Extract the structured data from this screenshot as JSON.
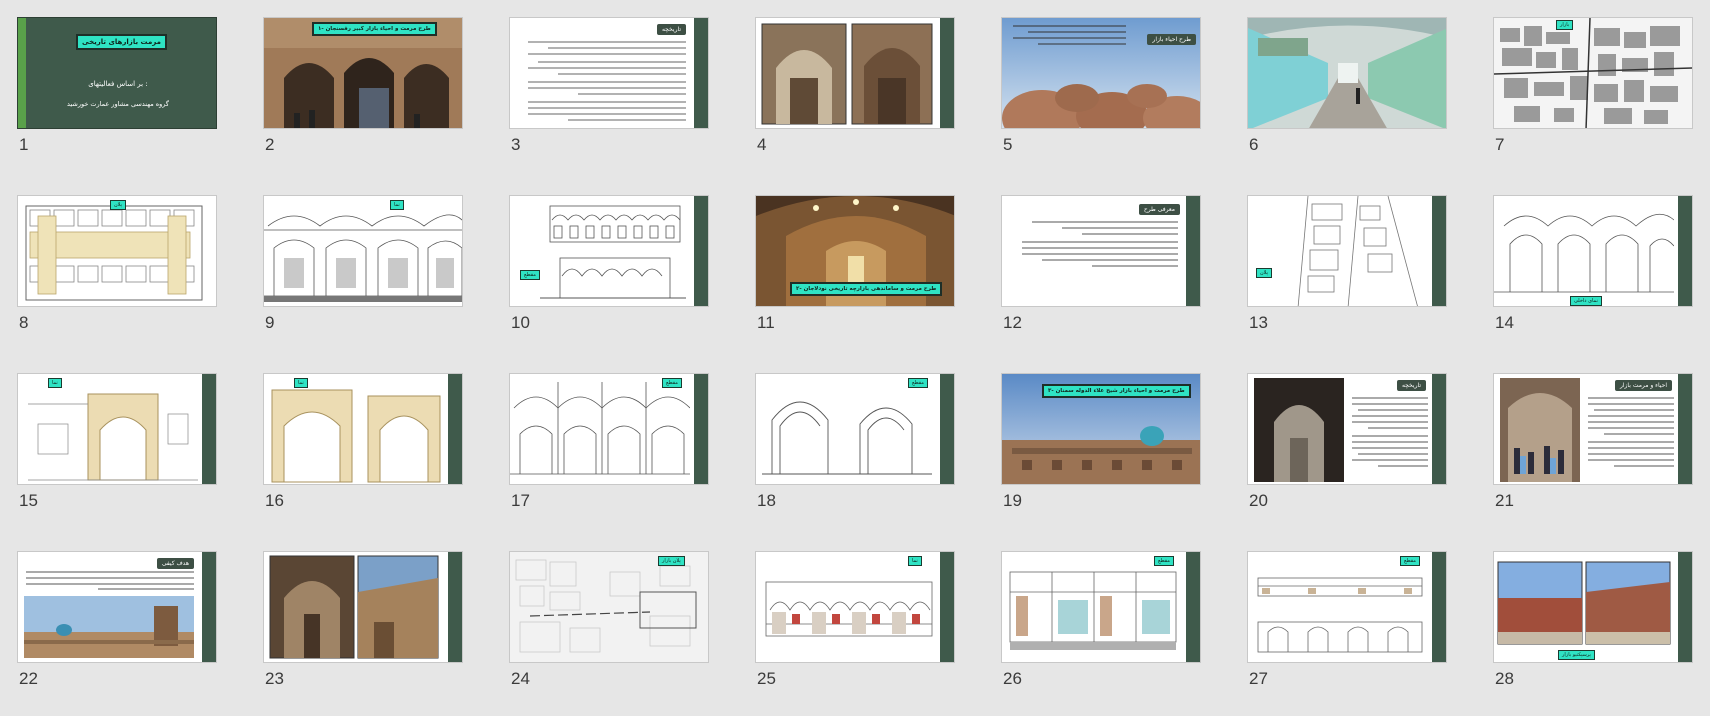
{
  "window": {
    "view": "slide-sorter",
    "slide_count": 28
  },
  "slides": [
    {
      "number": "1",
      "title": "مرمت بازارهای تاریخی",
      "subtitle": "بر اساس فعالیتهای :",
      "author": "گروه مهندسی مشاور عمارت خورشید"
    },
    {
      "number": "2",
      "caption": "۱- طرح مرمت و احیاء بازار کبیر رفسنجان"
    },
    {
      "number": "3",
      "title": "تاریخچه"
    },
    {
      "number": "4"
    },
    {
      "number": "5",
      "title": "طرح احیاء بازار"
    },
    {
      "number": "6"
    },
    {
      "number": "7",
      "tag": "بازار"
    },
    {
      "number": "8",
      "tag": "پلان"
    },
    {
      "number": "9",
      "tag": "نما"
    },
    {
      "number": "10",
      "tag": "مقطع"
    },
    {
      "number": "11",
      "caption": "۲- طرح مرمت و ساماندهی بازارچه تاریخی نودلاجان"
    },
    {
      "number": "12",
      "title": "معرفی طرح"
    },
    {
      "number": "13",
      "tag": "پلان"
    },
    {
      "number": "14",
      "tag": "نمای داخلی"
    },
    {
      "number": "15",
      "tag": "نما"
    },
    {
      "number": "16",
      "tag": "نما"
    },
    {
      "number": "17",
      "tag": "مقطع"
    },
    {
      "number": "18",
      "tag": "مقطع"
    },
    {
      "number": "19",
      "caption": "۳- طرح مرمت و احیاء بازار شیخ علاء الدوله سمنان"
    },
    {
      "number": "20",
      "title": "تاریخچه"
    },
    {
      "number": "21",
      "title": "احیاء و مرمت بازار"
    },
    {
      "number": "22",
      "title": "هدف کیفی"
    },
    {
      "number": "23"
    },
    {
      "number": "24",
      "tag": "پلان بازار"
    },
    {
      "number": "25",
      "tag": "نما"
    },
    {
      "number": "26",
      "tag": "مقطع"
    },
    {
      "number": "27",
      "tag": "مقطع"
    },
    {
      "number": "28",
      "tag": "پرسپکتیو بازار"
    }
  ]
}
